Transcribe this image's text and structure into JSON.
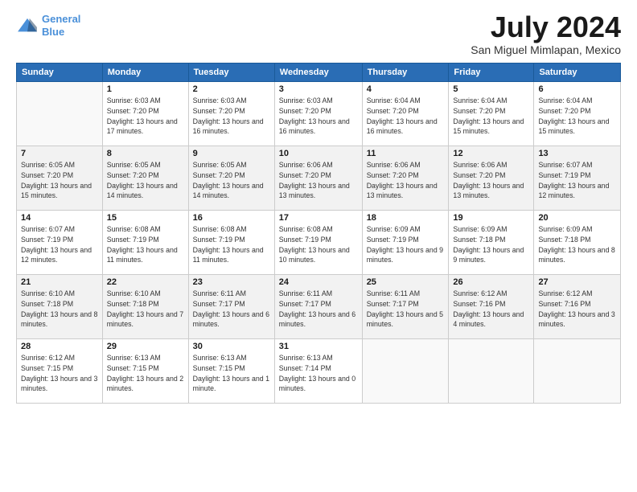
{
  "header": {
    "logo_line1": "General",
    "logo_line2": "Blue",
    "month": "July 2024",
    "location": "San Miguel Mimlapan, Mexico"
  },
  "days_of_week": [
    "Sunday",
    "Monday",
    "Tuesday",
    "Wednesday",
    "Thursday",
    "Friday",
    "Saturday"
  ],
  "weeks": [
    [
      {
        "day": "",
        "sunrise": "",
        "sunset": "",
        "daylight": ""
      },
      {
        "day": "1",
        "sunrise": "6:03 AM",
        "sunset": "7:20 PM",
        "daylight": "13 hours and 17 minutes."
      },
      {
        "day": "2",
        "sunrise": "6:03 AM",
        "sunset": "7:20 PM",
        "daylight": "13 hours and 16 minutes."
      },
      {
        "day": "3",
        "sunrise": "6:03 AM",
        "sunset": "7:20 PM",
        "daylight": "13 hours and 16 minutes."
      },
      {
        "day": "4",
        "sunrise": "6:04 AM",
        "sunset": "7:20 PM",
        "daylight": "13 hours and 16 minutes."
      },
      {
        "day": "5",
        "sunrise": "6:04 AM",
        "sunset": "7:20 PM",
        "daylight": "13 hours and 15 minutes."
      },
      {
        "day": "6",
        "sunrise": "6:04 AM",
        "sunset": "7:20 PM",
        "daylight": "13 hours and 15 minutes."
      }
    ],
    [
      {
        "day": "7",
        "sunrise": "6:05 AM",
        "sunset": "7:20 PM",
        "daylight": "13 hours and 15 minutes."
      },
      {
        "day": "8",
        "sunrise": "6:05 AM",
        "sunset": "7:20 PM",
        "daylight": "13 hours and 14 minutes."
      },
      {
        "day": "9",
        "sunrise": "6:05 AM",
        "sunset": "7:20 PM",
        "daylight": "13 hours and 14 minutes."
      },
      {
        "day": "10",
        "sunrise": "6:06 AM",
        "sunset": "7:20 PM",
        "daylight": "13 hours and 13 minutes."
      },
      {
        "day": "11",
        "sunrise": "6:06 AM",
        "sunset": "7:20 PM",
        "daylight": "13 hours and 13 minutes."
      },
      {
        "day": "12",
        "sunrise": "6:06 AM",
        "sunset": "7:20 PM",
        "daylight": "13 hours and 13 minutes."
      },
      {
        "day": "13",
        "sunrise": "6:07 AM",
        "sunset": "7:19 PM",
        "daylight": "13 hours and 12 minutes."
      }
    ],
    [
      {
        "day": "14",
        "sunrise": "6:07 AM",
        "sunset": "7:19 PM",
        "daylight": "13 hours and 12 minutes."
      },
      {
        "day": "15",
        "sunrise": "6:08 AM",
        "sunset": "7:19 PM",
        "daylight": "13 hours and 11 minutes."
      },
      {
        "day": "16",
        "sunrise": "6:08 AM",
        "sunset": "7:19 PM",
        "daylight": "13 hours and 11 minutes."
      },
      {
        "day": "17",
        "sunrise": "6:08 AM",
        "sunset": "7:19 PM",
        "daylight": "13 hours and 10 minutes."
      },
      {
        "day": "18",
        "sunrise": "6:09 AM",
        "sunset": "7:19 PM",
        "daylight": "13 hours and 9 minutes."
      },
      {
        "day": "19",
        "sunrise": "6:09 AM",
        "sunset": "7:18 PM",
        "daylight": "13 hours and 9 minutes."
      },
      {
        "day": "20",
        "sunrise": "6:09 AM",
        "sunset": "7:18 PM",
        "daylight": "13 hours and 8 minutes."
      }
    ],
    [
      {
        "day": "21",
        "sunrise": "6:10 AM",
        "sunset": "7:18 PM",
        "daylight": "13 hours and 8 minutes."
      },
      {
        "day": "22",
        "sunrise": "6:10 AM",
        "sunset": "7:18 PM",
        "daylight": "13 hours and 7 minutes."
      },
      {
        "day": "23",
        "sunrise": "6:11 AM",
        "sunset": "7:17 PM",
        "daylight": "13 hours and 6 minutes."
      },
      {
        "day": "24",
        "sunrise": "6:11 AM",
        "sunset": "7:17 PM",
        "daylight": "13 hours and 6 minutes."
      },
      {
        "day": "25",
        "sunrise": "6:11 AM",
        "sunset": "7:17 PM",
        "daylight": "13 hours and 5 minutes."
      },
      {
        "day": "26",
        "sunrise": "6:12 AM",
        "sunset": "7:16 PM",
        "daylight": "13 hours and 4 minutes."
      },
      {
        "day": "27",
        "sunrise": "6:12 AM",
        "sunset": "7:16 PM",
        "daylight": "13 hours and 3 minutes."
      }
    ],
    [
      {
        "day": "28",
        "sunrise": "6:12 AM",
        "sunset": "7:15 PM",
        "daylight": "13 hours and 3 minutes."
      },
      {
        "day": "29",
        "sunrise": "6:13 AM",
        "sunset": "7:15 PM",
        "daylight": "13 hours and 2 minutes."
      },
      {
        "day": "30",
        "sunrise": "6:13 AM",
        "sunset": "7:15 PM",
        "daylight": "13 hours and 1 minute."
      },
      {
        "day": "31",
        "sunrise": "6:13 AM",
        "sunset": "7:14 PM",
        "daylight": "13 hours and 0 minutes."
      },
      {
        "day": "",
        "sunrise": "",
        "sunset": "",
        "daylight": ""
      },
      {
        "day": "",
        "sunrise": "",
        "sunset": "",
        "daylight": ""
      },
      {
        "day": "",
        "sunrise": "",
        "sunset": "",
        "daylight": ""
      }
    ]
  ]
}
